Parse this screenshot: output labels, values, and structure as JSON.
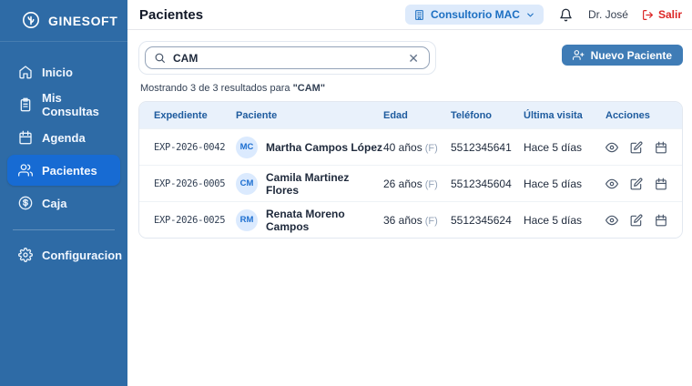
{
  "brand": {
    "name": "GINESOFT"
  },
  "sidebar": {
    "items": [
      {
        "label": "Inicio",
        "icon": "home-icon"
      },
      {
        "label": "Mis Consultas",
        "icon": "clipboard-icon"
      },
      {
        "label": "Agenda",
        "icon": "calendar-icon"
      },
      {
        "label": "Pacientes",
        "icon": "users-icon"
      },
      {
        "label": "Caja",
        "icon": "coin-icon"
      }
    ],
    "footer_item": {
      "label": "Configuracion",
      "icon": "gear-icon"
    }
  },
  "header": {
    "title": "Pacientes",
    "clinic_selector_label": "Consultorio MAC",
    "user_name": "Dr. José",
    "logout_label": "Salir"
  },
  "search": {
    "value": "CAM",
    "results_prefix": "Mostrando 3 de 3 resultados para",
    "results_query": "\"CAM\""
  },
  "toolbar": {
    "new_patient_label": "Nuevo Paciente"
  },
  "table": {
    "columns": [
      "Expediente",
      "Paciente",
      "Edad",
      "Teléfono",
      "Última visita",
      "Acciones"
    ],
    "rows": [
      {
        "expediente": "EXP-2026-0042",
        "initials": "MC",
        "name": "Martha Campos López",
        "age": "40 años",
        "sex": "(F)",
        "phone": "5512345641",
        "last_visit": "Hace 5 días"
      },
      {
        "expediente": "EXP-2026-0005",
        "initials": "CM",
        "name": "Camila Martinez Flores",
        "age": "26 años",
        "sex": "(F)",
        "phone": "5512345604",
        "last_visit": "Hace 5 días"
      },
      {
        "expediente": "EXP-2026-0025",
        "initials": "RM",
        "name": "Renata Moreno Campos",
        "age": "36 años",
        "sex": "(F)",
        "phone": "5512345624",
        "last_visit": "Hace 5 días"
      }
    ]
  },
  "colors": {
    "sidebar_bg": "#2e6ba6",
    "sidebar_active": "#176bd3",
    "table_header_bg": "#e9f1fb",
    "table_header_text": "#1e5b9e",
    "chip_bg": "#ddeafb",
    "chip_text": "#1c6fc2",
    "primary_button": "#3f7cb6",
    "logout_red": "#dc2626",
    "avatar_bg": "#dbeafe",
    "avatar_text": "#1d6fd0"
  }
}
